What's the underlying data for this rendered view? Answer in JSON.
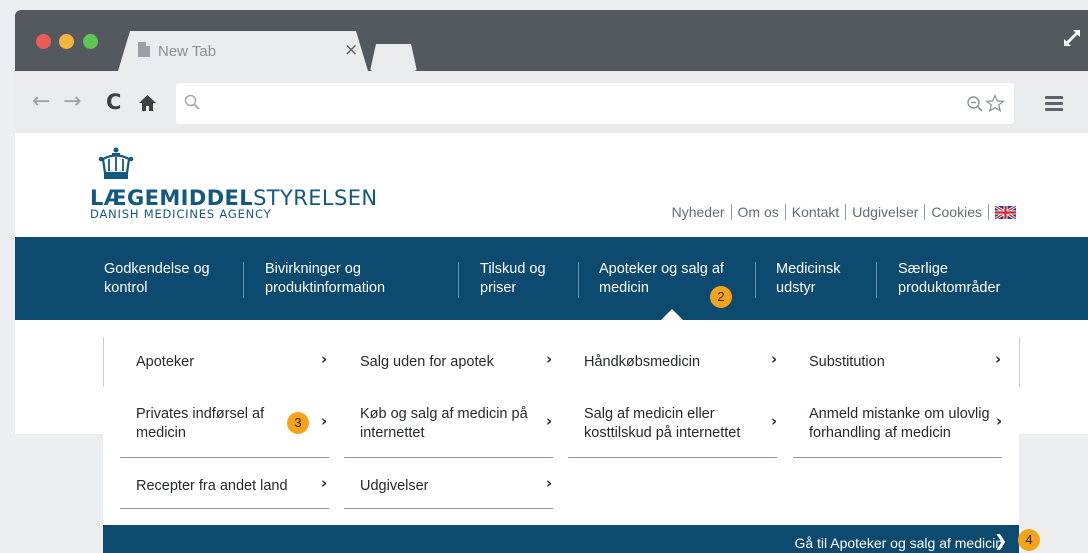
{
  "browser": {
    "window_controls": [
      "close",
      "minimize",
      "zoom"
    ],
    "tab": {
      "title": "New Tab",
      "close_glyph": "×"
    },
    "nav_buttons": {
      "back": "←",
      "forward": "→",
      "reload": "C",
      "home": "⌂"
    },
    "omnibox": {
      "value": "",
      "placeholder": ""
    },
    "colors": {
      "close": "#ec5c56",
      "minimize": "#f4b53d",
      "zoom": "#5fc554"
    }
  },
  "site": {
    "logo": {
      "main_bold": "LÆGEMIDDEL",
      "main_regular": "STYRELSEN",
      "sub": "DANISH MEDICINES AGENCY"
    },
    "utility_links": [
      "Nyheder",
      "Om os",
      "Kontakt",
      "Udgivelser",
      "Cookies"
    ],
    "main_nav": [
      {
        "label": "Godkendelse og kontrol",
        "line1": "Godkendelse og",
        "line2": "kontrol"
      },
      {
        "label": "Bivirkninger og produktinformation",
        "line1": "Bivirkninger og",
        "line2": "produktinformation"
      },
      {
        "label": "Tilskud og priser",
        "line1": "Tilskud og",
        "line2": "priser"
      },
      {
        "label": "Apoteker og salg af medicin",
        "line1": "Apoteker og salg af",
        "line2": "medicin"
      },
      {
        "label": "Medicinsk udstyr",
        "line1": "Medicinsk",
        "line2": "udstyr"
      },
      {
        "label": "Særlige produktområder",
        "line1": "Særlige",
        "line2": "produktområder"
      }
    ],
    "mega_menu": {
      "rows": [
        [
          {
            "line1": "Apoteker",
            "line2": ""
          },
          {
            "line1": "Salg uden for apotek",
            "line2": ""
          },
          {
            "line1": "Håndkøbsmedicin",
            "line2": ""
          },
          {
            "line1": "Substitution",
            "line2": ""
          }
        ],
        [
          {
            "line1": "Privates indførsel af",
            "line2": "medicin"
          },
          {
            "line1": "Køb og salg af medicin på",
            "line2": "internettet"
          },
          {
            "line1": "Salg af medicin eller",
            "line2": "kosttilskud på internettet"
          },
          {
            "line1": "Anmeld mistanke om ulovlig",
            "line2": "forhandling af medicin"
          }
        ],
        [
          {
            "line1": "Recepter fra andet land",
            "line2": ""
          },
          {
            "line1": "Udgivelser",
            "line2": ""
          }
        ]
      ],
      "chevron": "›",
      "goto_label": "Gå til Apoteker og salg af medicin",
      "goto_chevron": "❯"
    },
    "colors": {
      "brand_blue": "#0d4a6f",
      "logo_blue": "#12587f",
      "badge": "#f5a31a"
    }
  },
  "annotations": [
    "2",
    "3",
    "4"
  ]
}
